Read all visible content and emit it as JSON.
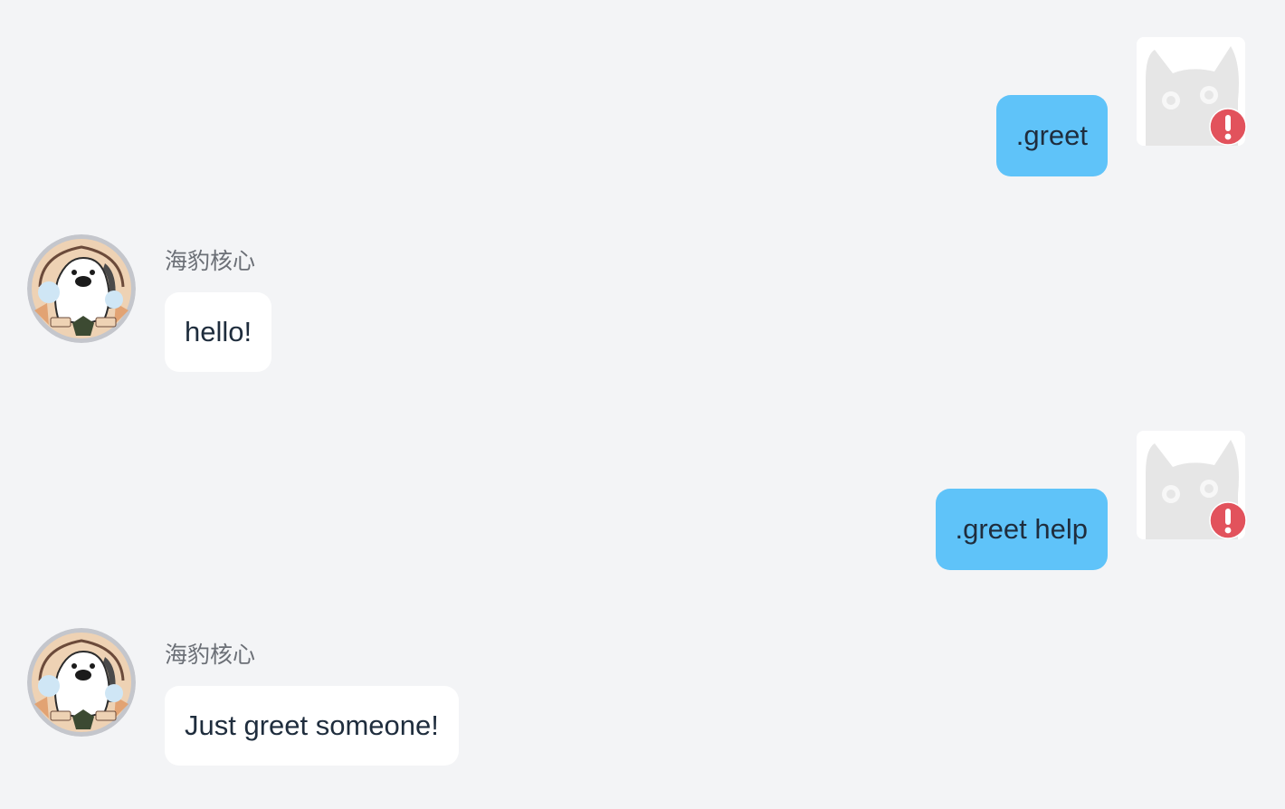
{
  "messages": [
    {
      "role": "user",
      "text": ".greet",
      "status": "error"
    },
    {
      "role": "bot",
      "sender": "海豹核心",
      "text": "hello!"
    },
    {
      "role": "user",
      "text": ".greet help",
      "status": "error"
    },
    {
      "role": "bot",
      "sender": "海豹核心",
      "text": "Just greet someone!"
    }
  ],
  "colors": {
    "background": "#f3f4f6",
    "user_bubble": "#5fc3f9",
    "bot_bubble": "#ffffff",
    "error_badge": "#e2525c"
  },
  "icons": {
    "user_avatar": "default-cat-avatar-icon",
    "error": "exclamation-circle-icon",
    "bot_avatar": "seal-dice-logo"
  }
}
